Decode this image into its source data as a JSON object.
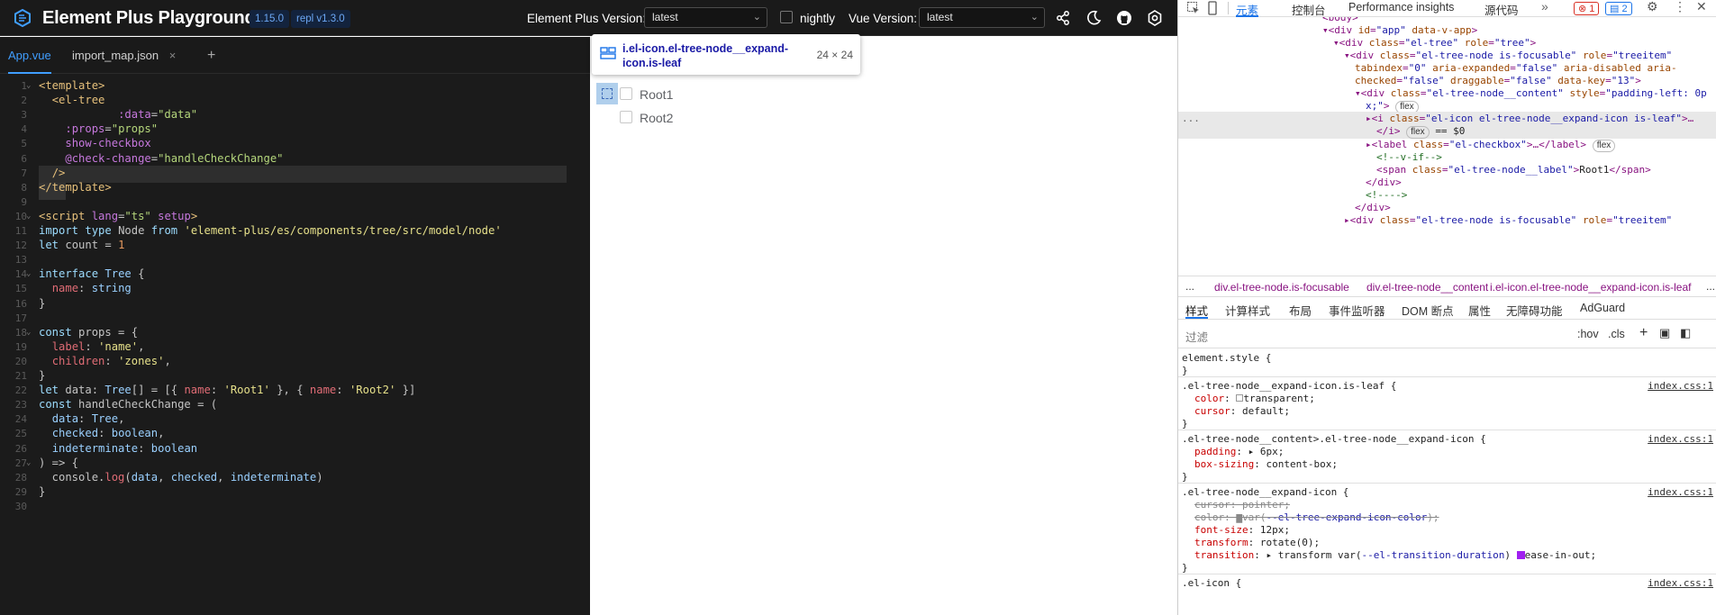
{
  "header": {
    "title": "Element Plus Playground",
    "version_badge": "1.15.0",
    "repl_badge": "repl v1.3.0",
    "ep_version_label": "Element Plus Version:",
    "ep_version_value": "latest",
    "nightly_label": "nightly",
    "vue_version_label": "Vue Version:",
    "vue_version_value": "latest",
    "icons": [
      "share-icon",
      "moon-icon",
      "github-icon",
      "settings-icon"
    ]
  },
  "editor": {
    "tabs": [
      {
        "label": "App.vue",
        "active": true
      },
      {
        "label": "import_map.json",
        "close": "×"
      },
      {
        "label": "+"
      }
    ],
    "lines": [
      {
        "n": "1",
        "fold": true,
        "html": "<span style='color:#e6c07b'>&lt;template&gt;</span>"
      },
      {
        "n": "2",
        "html": "  <span style='color:#e6c07b'>&lt;el-tree</span>"
      },
      {
        "n": "3",
        "html": "            <span style='color:#c678dd'>:data</span>=<span style='color:#b5d77c'>\"data\"</span>"
      },
      {
        "n": "4",
        "html": "    <span style='color:#c678dd'>:props</span>=<span style='color:#b5d77c'>\"props\"</span>"
      },
      {
        "n": "5",
        "html": "    <span style='color:#c678dd'>show-checkbox</span>"
      },
      {
        "n": "6",
        "html": "    <span style='color:#c678dd'>@check-change</span>=<span style='color:#b5d77c'>\"handleCheckChange\"</span>"
      },
      {
        "n": "7",
        "html": "  <span style='color:#e6c07b'>/&gt;</span>"
      },
      {
        "n": "8",
        "html": "<span style='color:#e6c07b'>&lt;/template&gt;</span>"
      },
      {
        "n": "9",
        "html": ""
      },
      {
        "n": "10",
        "fold": true,
        "html": "<span style='color:#e6c07b'>&lt;script</span> <span style='color:#c678dd'>lang</span>=<span style='color:#b5d77c'>\"ts\"</span> <span style='color:#c678dd'>setup</span><span style='color:#e6c07b'>&gt;</span>"
      },
      {
        "n": "11",
        "html": "<span style='color:#9cdcfe'>import</span> <span style='color:#9cdcfe'>type</span> <span style='color:#c4c4c4'>Node</span> <span style='color:#9cdcfe'>from</span> <span style='color:#e6e08a'>'element-plus/es/components/tree/src/model/node'</span>"
      },
      {
        "n": "12",
        "html": "<span style='color:#9cdcfe'>let</span> count = <span style='color:#e6995e'>1</span>"
      },
      {
        "n": "13",
        "html": ""
      },
      {
        "n": "14",
        "fold": true,
        "html": "<span style='color:#9cdcfe'>interface</span> <span style='color:#9ad0ff'>Tree</span> {"
      },
      {
        "n": "15",
        "html": "  <span style='color:#e06c75'>name</span>: <span style='color:#9ad0ff'>string</span>"
      },
      {
        "n": "16",
        "html": "}"
      },
      {
        "n": "17",
        "html": ""
      },
      {
        "n": "18",
        "fold": true,
        "html": "<span style='color:#9cdcfe'>const</span> props = {"
      },
      {
        "n": "19",
        "html": "  <span style='color:#e06c75'>label</span>: <span style='color:#e6e08a'>'name'</span>,"
      },
      {
        "n": "20",
        "html": "  <span style='color:#e06c75'>children</span>: <span style='color:#e6e08a'>'zones'</span>,"
      },
      {
        "n": "21",
        "html": "}"
      },
      {
        "n": "22",
        "html": "<span style='color:#9cdcfe'>let</span> data: <span style='color:#9ad0ff'>Tree</span>[] = [{ <span style='color:#e06c75'>name</span>: <span style='color:#e6e08a'>'Root1'</span> }, { <span style='color:#e06c75'>name</span>: <span style='color:#e6e08a'>'Root2'</span> }]"
      },
      {
        "n": "23",
        "html": "<span style='color:#9cdcfe'>const</span> handleCheckChange = ("
      },
      {
        "n": "24",
        "html": "  <span style='color:#9ad0ff'>data</span>: <span style='color:#9ad0ff'>Tree</span>,"
      },
      {
        "n": "25",
        "html": "  <span style='color:#9ad0ff'>checked</span>: <span style='color:#9ad0ff'>boolean</span>,"
      },
      {
        "n": "26",
        "html": "  <span style='color:#9ad0ff'>indeterminate</span>: <span style='color:#9ad0ff'>boolean</span>"
      },
      {
        "n": "27",
        "fold": true,
        "html": ") =&gt; {"
      },
      {
        "n": "28",
        "html": "  console.<span style='color:#e06c75'>log</span>(<span style='color:#9ad0ff'>data</span>, <span style='color:#9ad0ff'>checked</span>, <span style='color:#9ad0ff'>indeterminate</span>)"
      },
      {
        "n": "29",
        "html": "}"
      },
      {
        "n": "30",
        "html": ""
      }
    ]
  },
  "preview": {
    "tooltip_selector": "i.el-icon.el-tree-node__expand-icon.is-leaf",
    "tooltip_size": "24 × 24",
    "nodes": [
      "Root1",
      "Root2"
    ]
  },
  "devtools": {
    "tabs": [
      "元素",
      "控制台",
      "Performance insights",
      "源代码"
    ],
    "more": "»",
    "errors": "1",
    "messages": "2",
    "breadcrumbs": [
      "...",
      "div.el-tree-node.is-focusable",
      "div.el-tree-node__content",
      "i.el-icon.el-tree-node__expand-icon.is-leaf",
      "..."
    ],
    "style_tabs": [
      "样式",
      "计算样式",
      "布局",
      "事件监听器",
      "DOM 断点",
      "属性",
      "无障碍功能",
      "AdGuard"
    ],
    "filter_placeholder": "过滤",
    "hov": ":hov",
    "cls": ".cls",
    "source": "index.css:1"
  },
  "colors": {
    "accent": "#409eff",
    "header_bg": "#1a1a1a",
    "editor_bg": "#1b1b1b"
  }
}
